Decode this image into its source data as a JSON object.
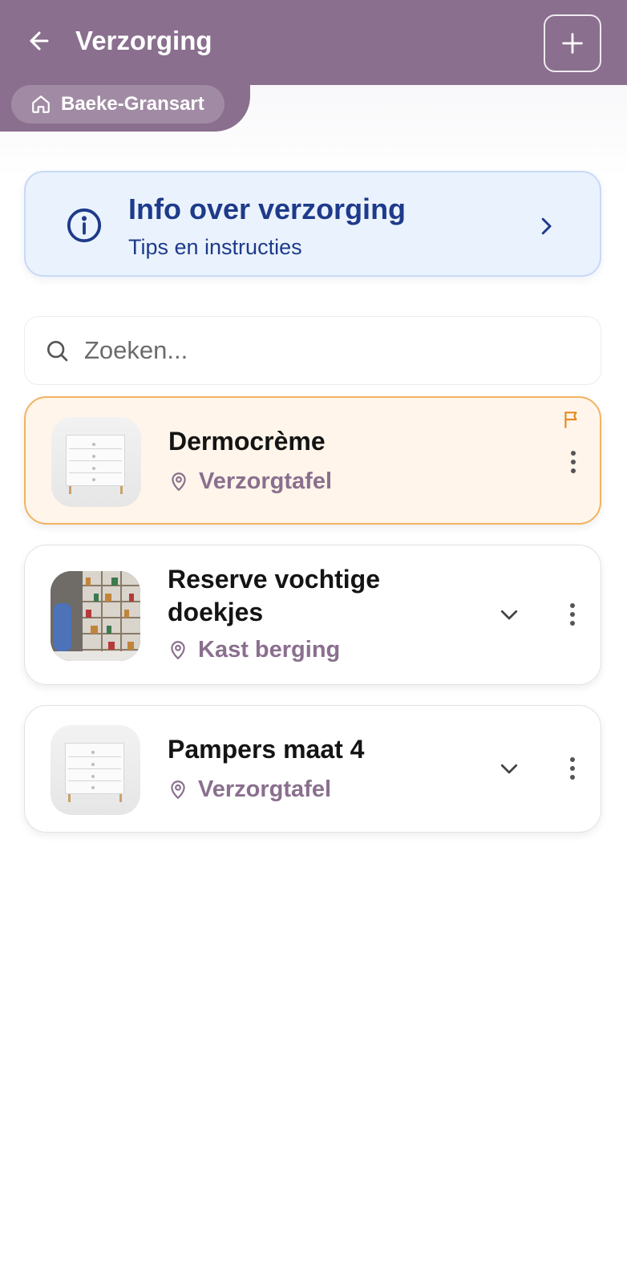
{
  "header": {
    "title": "Verzorging",
    "household": "Baeke-Gransart",
    "color": "#8a6f8e"
  },
  "info_card": {
    "title": "Info over verzorging",
    "subtitle": "Tips en instructies"
  },
  "search": {
    "placeholder": "Zoeken...",
    "value": ""
  },
  "items": [
    {
      "name": "Dermocrème",
      "location": "Verzorgtafel",
      "image": "changing-table-dresser",
      "flagged": true
    },
    {
      "name": "Reserve vochtige doekjes",
      "location": "Kast berging",
      "image": "storage-shelves",
      "flagged": false
    },
    {
      "name": "Pampers maat 4",
      "location": "Verzorgtafel",
      "image": "changing-table-dresser",
      "flagged": false
    }
  ],
  "colors": {
    "accent": "#8a6f8e",
    "info_bg": "#eaf3fd",
    "info_text": "#1e3a8a",
    "flag": "#e58a23",
    "flagged_bg": "#fff5ea"
  }
}
